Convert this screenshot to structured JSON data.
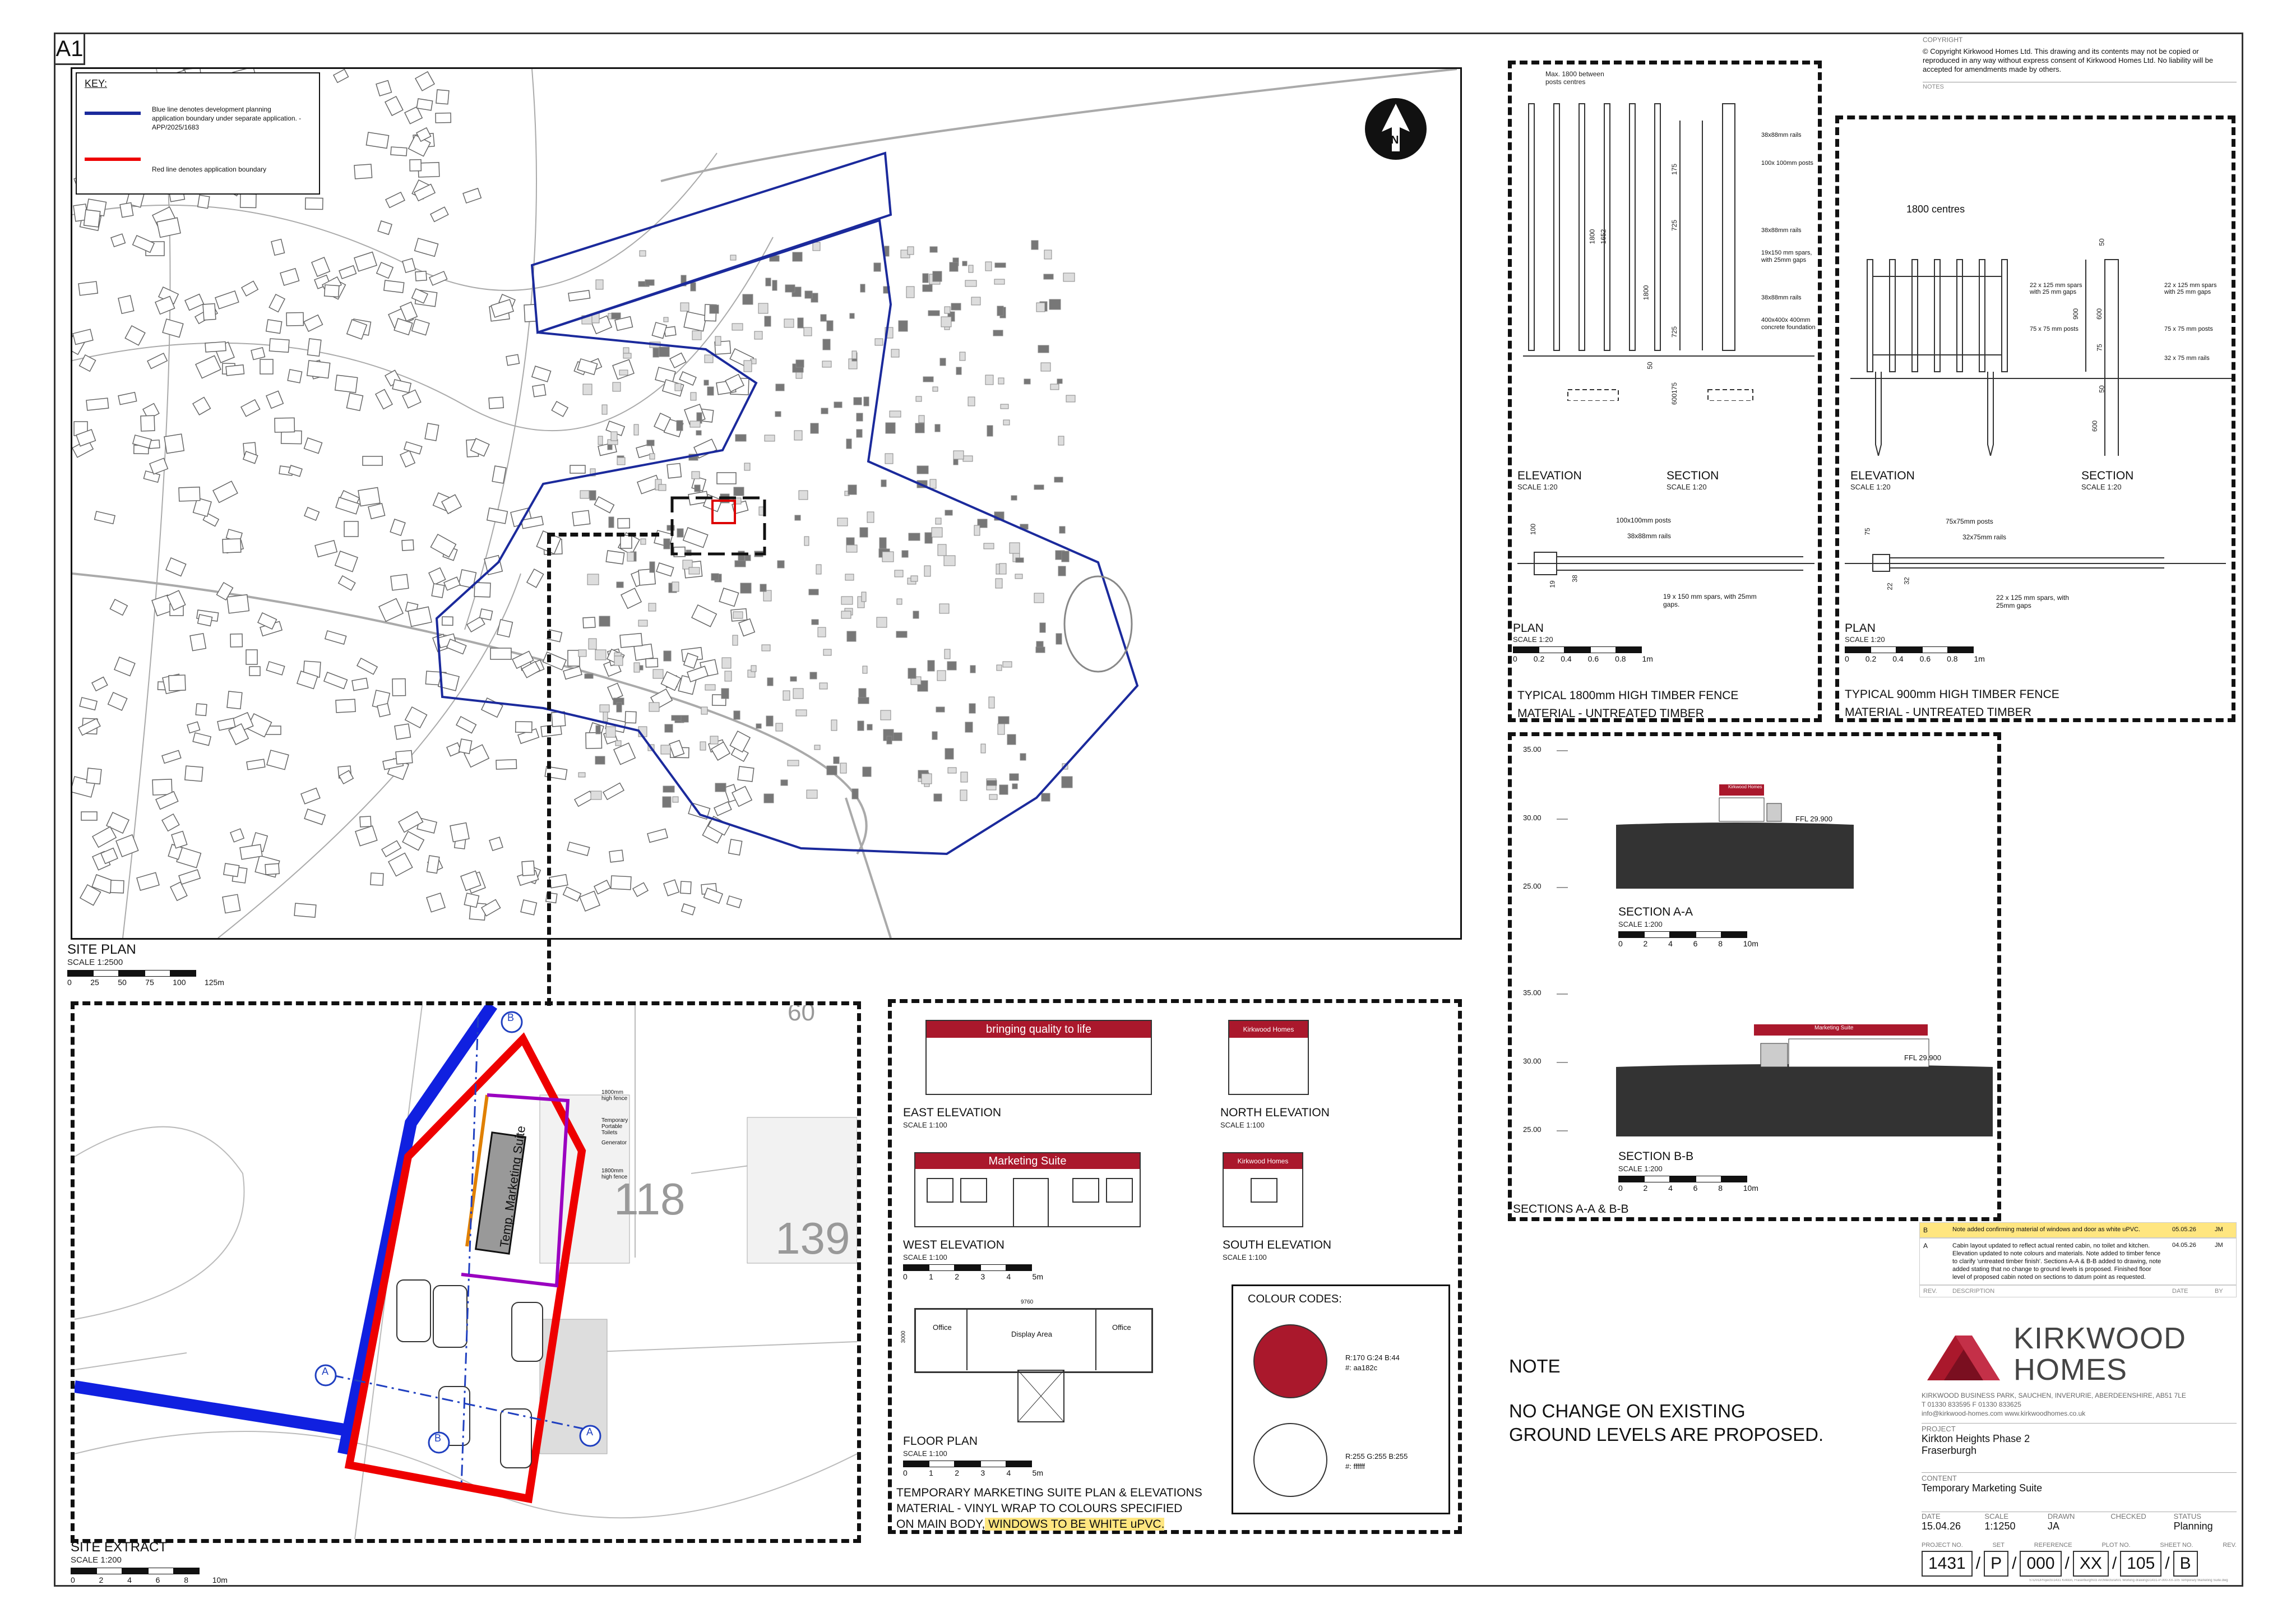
{
  "sheet": {
    "size": "A1"
  },
  "key": {
    "title": "KEY:",
    "blue_label": "Blue line denotes development planning application boundary under separate application. -APP/2025/1683",
    "red_label": "Red line denotes application boundary"
  },
  "site_plan": {
    "title": "SITE PLAN",
    "scale": "SCALE 1:2500",
    "ticks": [
      "0",
      "25",
      "50",
      "75",
      "100",
      "125m"
    ],
    "north": "N"
  },
  "site_extract": {
    "title": "SITE EXTRACT",
    "scale": "SCALE 1:200",
    "ticks": [
      "0",
      "2",
      "4",
      "6",
      "8",
      "10m"
    ],
    "plot_118": "118",
    "plot_139": "139",
    "plot_60": "60",
    "suite_label": "Temp. Marketing Suite",
    "labels": {
      "b": "B",
      "a": "A",
      "generator": "Generator",
      "toilets": "Temporary Portable Toilets",
      "fence1": "1800mm high fence",
      "fence2": "1800mm high fence"
    }
  },
  "fence1800": {
    "elev_title": "ELEVATION",
    "elev_scale": "SCALE 1:20",
    "section_title": "SECTION",
    "section_scale": "SCALE 1:20",
    "plan_title": "PLAN",
    "plan_scale": "SCALE 1:20",
    "ticks": [
      "0",
      "0.2",
      "0.4",
      "0.6",
      "0.8",
      "1m"
    ],
    "caption1": "TYPICAL 1800mm HIGH TIMBER FENCE",
    "caption2": "MATERIAL - UNTREATED TIMBER",
    "note_max": "Max. 1800 between posts centres",
    "dims": {
      "d175a": "175",
      "d725a": "725",
      "d725b": "725",
      "d175b": "175",
      "d1800": "1800",
      "d1800b": "1800",
      "d1652": "1652",
      "d50": "50",
      "d600": "600",
      "d100": "100",
      "d19": "19",
      "d38": "38"
    },
    "notes": {
      "rails1": "38x88mm rails",
      "posts": "100x 100mm posts",
      "rails2": "38x88mm rails",
      "spars": "19x150 mm spars, with 25mm gaps",
      "rails3": "38x88mm rails",
      "found": "400x400x 400mm concrete foundation",
      "plan_posts": "100x100mm posts",
      "plan_rails": "38x88mm rails",
      "plan_spars": "19 x 150 mm spars, with 25mm gaps."
    }
  },
  "fence900": {
    "centres": "1800 centres",
    "elev_title": "ELEVATION",
    "elev_scale": "SCALE 1:20",
    "section_title": "SECTION",
    "section_scale": "SCALE 1:20",
    "plan_title": "PLAN",
    "plan_scale": "SCALE 1:20",
    "ticks": [
      "0",
      "0.2",
      "0.4",
      "0.6",
      "0.8",
      "1m"
    ],
    "caption1": "TYPICAL 900mm HIGH TIMBER FENCE",
    "caption2": "MATERIAL - UNTREATED TIMBER",
    "dims": {
      "d50": "50",
      "d600": "600",
      "d75": "75",
      "d900": "900",
      "d50b": "50",
      "d600b": "600",
      "d75b": "75",
      "d22": "22",
      "d32": "32"
    },
    "notes": {
      "spars": "22 x 125 mm spars with 25 mm gaps",
      "posts": "75 x 75 mm posts",
      "spars2": "22 x 125 mm spars with 25 mm gaps",
      "posts2": "75 x 75 mm posts",
      "rails": "32 x 75 mm rails",
      "plan_posts": "75x75mm posts",
      "plan_rails": "32x75mm rails",
      "plan_spars": "22 x 125 mm spars, with 25mm gaps"
    }
  },
  "sections": {
    "title": "SECTIONS A-A & B-B",
    "aa_title": "SECTION A-A",
    "aa_scale": "SCALE 1:200",
    "bb_title": "SECTION B-B",
    "bb_scale": "SCALE 1:200",
    "levels_a": [
      "35.00",
      "30.00",
      "25.00"
    ],
    "levels_b": [
      "35.00",
      "30.00",
      "25.00"
    ],
    "ffl": "FFL 29.900",
    "ffl2": "FFL 29.900",
    "ticks": [
      "0",
      "2",
      "4",
      "6",
      "8",
      "10m"
    ],
    "sign_a": "Kirkwood Homes",
    "sign_b": "Marketing Suite"
  },
  "suite": {
    "east_title": "EAST ELEVATION",
    "east_scale": "SCALE 1:100",
    "north_title": "NORTH ELEVATION",
    "north_scale": "SCALE 1:100",
    "west_title": "WEST ELEVATION",
    "west_scale": "SCALE 1:100",
    "south_title": "SOUTH ELEVATION",
    "south_scale": "SCALE 1:100",
    "floor_title": "FLOOR PLAN",
    "floor_scale": "SCALE 1:100",
    "ticks": [
      "0",
      "1",
      "2",
      "3",
      "4",
      "5m"
    ],
    "banner_east": "bringing quality to life",
    "banner_north": "Kirkwood Homes",
    "banner_west": "Marketing Suite",
    "banner_south": "Kirkwood Homes",
    "room_office1": "Office",
    "room_display": "Display Area",
    "room_office2": "Office",
    "dim_width": "9760",
    "dim_depth": "3000",
    "caption1": "TEMPORARY MARKETING SUITE PLAN & ELEVATIONS",
    "caption2": "MATERIAL - VINYL WRAP TO COLOURS SPECIFIED",
    "caption3a": "ON MAIN BODY,",
    "caption3b": " WINDOWS TO BE WHITE uPVC."
  },
  "colours": {
    "title": "COLOUR CODES:",
    "red": "#aa182c",
    "white": "#ffffff",
    "red_rgb": "R:170 G:24 B:44",
    "red_hex": "#: aa182c",
    "white_rgb": "R:255 G:255 B:255",
    "white_hex": "#: ffffff"
  },
  "note": {
    "title": "NOTE",
    "line1": "NO CHANGE ON EXISTING",
    "line2": "GROUND LEVELS ARE PROPOSED."
  },
  "copyright": {
    "head": "COPYRIGHT",
    "text": "© Copyright Kirkwood Homes Ltd. This drawing and its contents may not be copied or reproduced in any way without express consent of Kirkwood Homes Ltd. No liability will be accepted for amendments made by others.",
    "notes_head": "NOTES"
  },
  "revisions": {
    "rows": [
      {
        "rev": "B",
        "desc": "Note added confirming material of windows and door as white uPVC.",
        "date": "05.05.26",
        "by": "JM"
      },
      {
        "rev": "A",
        "desc": "Cabin layout updated to reflect actual rented cabin, no toilet and kitchen. Elevation updated to note colours and materials. Note added to timber fence to clarify 'untreated timber finish'. Sections A-A & B-B added to drawing, note added stating that no change to ground levels is proposed. Finished floor level of proposed cabin noted on sections to datum point as requested.",
        "date": "04.05.26",
        "by": "JM"
      }
    ],
    "head_rev": "REV.",
    "head_desc": "DESCRIPTION",
    "head_date": "DATE",
    "head_by": "BY"
  },
  "company": {
    "name1": "KIRKWOOD",
    "name2": "HOMES",
    "address": "KIRKWOOD BUSINESS PARK, SAUCHEN, INVERURIE, ABERDEENSHIRE, AB51 7LE",
    "phone": "T 01330 833595     F 01330 833625",
    "email": "info@kirkwood-homes.com     www.kirkwoodhomes.co.uk"
  },
  "titleblock": {
    "project_head": "PROJECT",
    "project1": "Kirkton Heights Phase 2",
    "project2": "Fraserburgh",
    "content_head": "CONTENT",
    "content": "Temporary Marketing Suite",
    "date_head": "DATE",
    "date": "15.04.26",
    "scale_head": "SCALE",
    "scale": "1:1250",
    "drawn_head": "DRAWN",
    "drawn": "JA",
    "checked_head": "CHECKED",
    "checked": "",
    "status_head": "STATUS",
    "status": "Planning",
    "project_no_head": "PROJECT NO.",
    "set_head": "SET",
    "ref_head": "REFERENCE",
    "plot_head": "PLOT NO.",
    "sheet_head": "SHEET NO.",
    "rev_head": "REV.",
    "project_no": "1431",
    "set": "P",
    "ref": "000",
    "plot": "XX",
    "sheet": "105",
    "rev": "B",
    "path": "S:\\DVDProjects\\1431 Kirkton, Fraserburgh\\03 Architectural\\01 Working drawings\\1431-P-000-XX-105 Temporary Marketing Suite.dwg"
  }
}
